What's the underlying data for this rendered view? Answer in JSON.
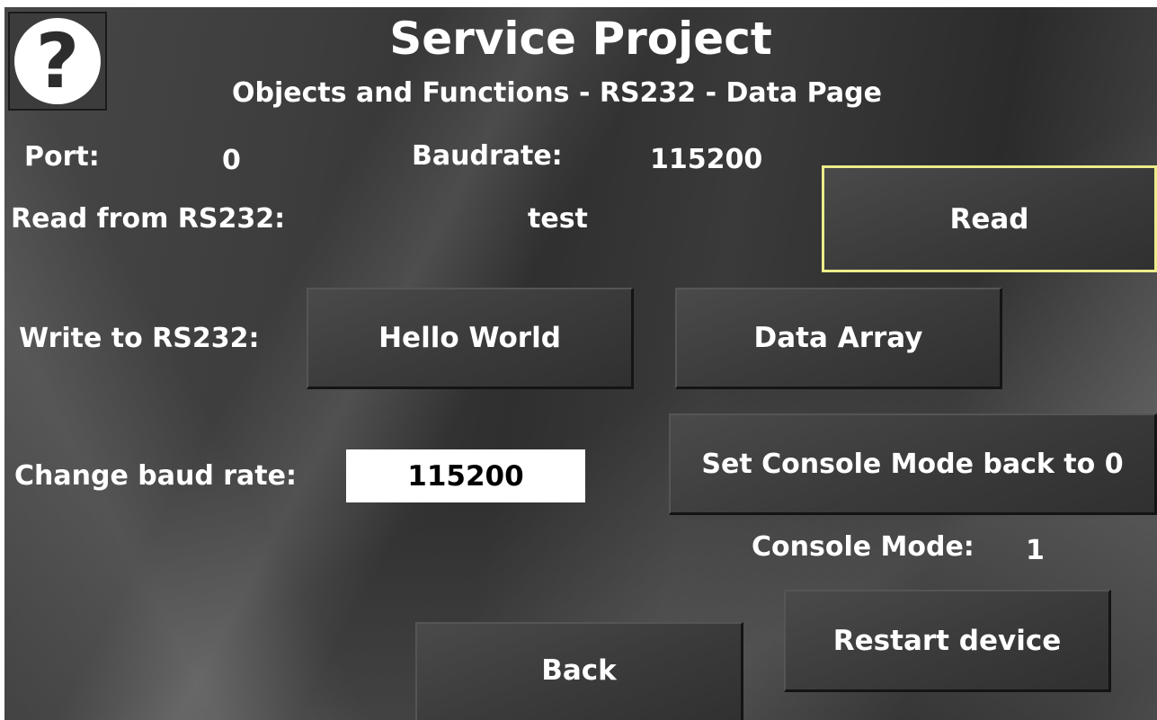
{
  "header": {
    "title": "Service Project",
    "subtitle": "Objects and Functions - RS232 - Data Page",
    "help_icon": "?"
  },
  "port": {
    "label": "Port:",
    "value": "0"
  },
  "baudrate": {
    "label": "Baudrate:",
    "value": "115200"
  },
  "read": {
    "label": "Read from RS232:",
    "value": "test",
    "button_label": "Read"
  },
  "write": {
    "label": "Write to RS232:",
    "hello_button": "Hello World",
    "array_button": "Data Array"
  },
  "change_baud": {
    "label": "Change baud rate:",
    "value": "115200"
  },
  "console": {
    "reset_button": "Set Console Mode back to 0",
    "label": "Console Mode:",
    "value": "1"
  },
  "footer": {
    "restart_button": "Restart device",
    "back_button": "Back"
  },
  "colors": {
    "focus_outline": "#ecec8a",
    "input_bg": "#ffffff"
  }
}
